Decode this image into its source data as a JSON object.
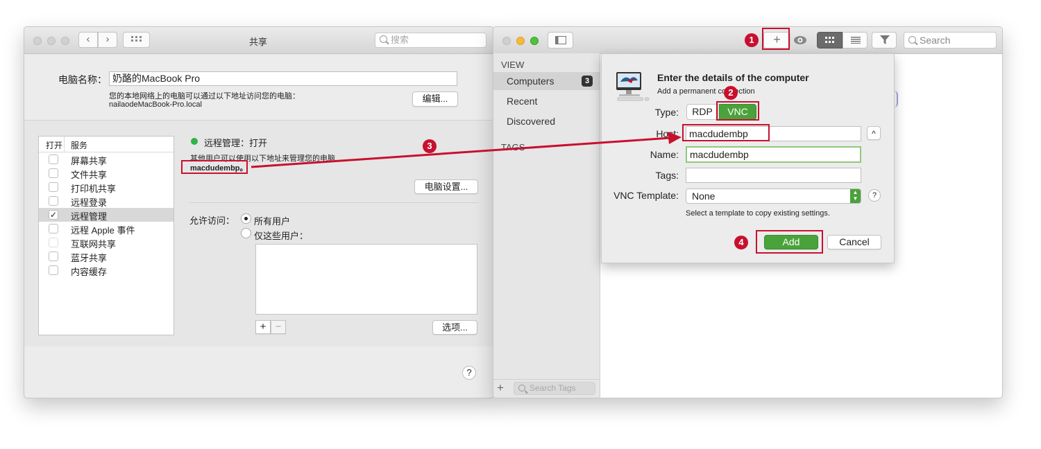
{
  "left_window": {
    "title": "共享",
    "search_placeholder": "搜索",
    "computer_name_label": "电脑名称：",
    "computer_name_value": "奶酪的MacBook Pro",
    "local_address_desc": "您的本地网络上的电脑可以通过以下地址访问您的电脑：",
    "local_address": "nailaodeMacBook-Pro.local",
    "edit_button": "编辑...",
    "services_header": {
      "on": "打开",
      "service": "服务"
    },
    "services": [
      {
        "label": "屏幕共享",
        "checked": false
      },
      {
        "label": "文件共享",
        "checked": false
      },
      {
        "label": "打印机共享",
        "checked": false
      },
      {
        "label": "远程登录",
        "checked": false
      },
      {
        "label": "远程管理",
        "checked": true
      },
      {
        "label": "远程 Apple 事件",
        "checked": false
      },
      {
        "label": "互联网共享",
        "checked": false
      },
      {
        "label": "蓝牙共享",
        "checked": false
      },
      {
        "label": "内容缓存",
        "checked": false
      }
    ],
    "status_text": "远程管理：打开",
    "status_color": "#2fb34a",
    "manage_desc": "其他用户可以使用以下地址来管理您的电脑",
    "manage_address": "macdudembp。",
    "computer_settings_button": "电脑设置...",
    "allow_access_label": "允许访问：",
    "allow_all_users": "所有用户",
    "allow_only_users": "仅这些用户：",
    "add_symbol": "+",
    "remove_symbol": "−",
    "options_button": "选项...",
    "help_symbol": "?"
  },
  "right_window": {
    "search_placeholder": "Search",
    "add_symbol": "+",
    "sidebar": {
      "view_header": "VIEW",
      "items": [
        {
          "label": "Computers",
          "badge": "3"
        },
        {
          "label": "Recent"
        },
        {
          "label": "Discovered"
        }
      ],
      "tags_header": "TAGS",
      "search_tags_placeholder": "Search Tags",
      "add_symbol": "+"
    },
    "sheet": {
      "title": "Enter the details of the computer",
      "subtitle": "Add a permanent connection",
      "type_label": "Type:",
      "type_options": [
        "RDP",
        "VNC"
      ],
      "type_selected": "VNC",
      "host_label": "Host:",
      "host_value": "macdudembp",
      "name_label": "Name:",
      "name_value": "macdudembp",
      "tags_label": "Tags:",
      "tags_value": "",
      "template_label": "VNC Template:",
      "template_value": "None",
      "template_hint": "Select a template to copy existing settings.",
      "add_button": "Add",
      "cancel_button": "Cancel",
      "help_symbol": "?",
      "collapse_symbol": "^"
    }
  },
  "annotations": {
    "markers": [
      "1",
      "2",
      "3",
      "4"
    ],
    "color": "#c8102e"
  },
  "colors": {
    "accent_green": "#4aa23a",
    "highlight_red": "#c8102e"
  }
}
